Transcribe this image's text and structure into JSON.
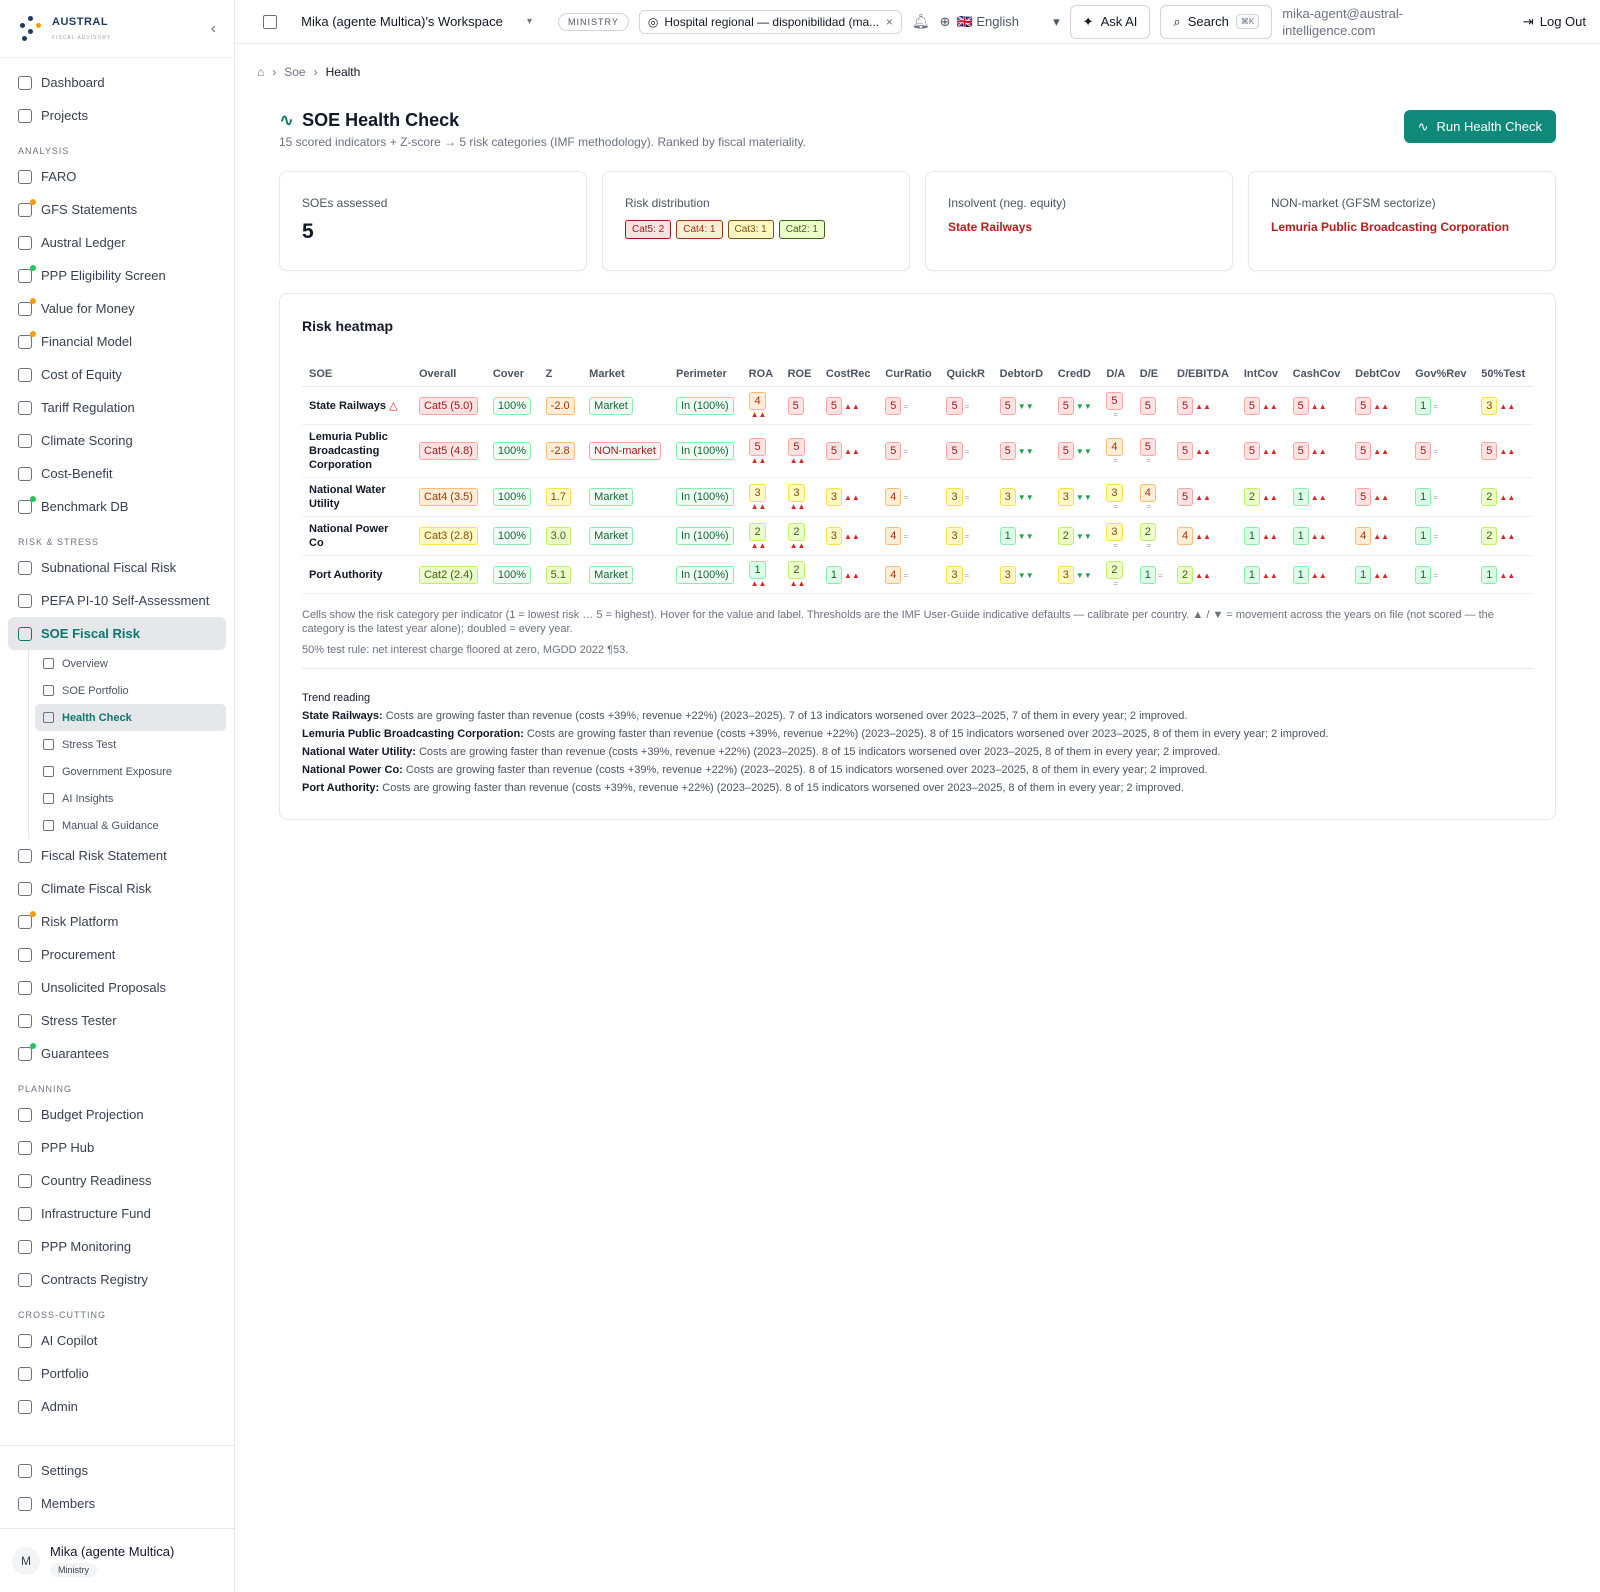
{
  "brand": {
    "name": "AUSTRAL",
    "tagline": "FISCAL ADVISORY"
  },
  "sidebar": {
    "top": [
      {
        "label": "Dashboard",
        "icon": "grid-icon"
      },
      {
        "label": "Projects",
        "icon": "folder-icon"
      }
    ],
    "sections": [
      {
        "title": "ANALYSIS",
        "items": [
          {
            "label": "FARO",
            "icon": "compass-icon"
          },
          {
            "label": "GFS Statements",
            "icon": "calculator-icon",
            "dot": "#f59e0b"
          },
          {
            "label": "Austral Ledger",
            "icon": "book-icon"
          },
          {
            "label": "PPP Eligibility Screen",
            "icon": "clipboard-check-icon",
            "dot": "#22c55e"
          },
          {
            "label": "Value for Money",
            "icon": "scale-icon",
            "dot": "#f59e0b"
          },
          {
            "label": "Financial Model",
            "icon": "sheet-icon",
            "dot": "#f59e0b"
          },
          {
            "label": "Cost of Equity",
            "icon": "trending-up-icon"
          },
          {
            "label": "Tariff Regulation",
            "icon": "gauge-icon"
          },
          {
            "label": "Climate Scoring",
            "icon": "cloud-icon"
          },
          {
            "label": "Cost-Benefit",
            "icon": "scale-icon"
          },
          {
            "label": "Benchmark DB",
            "icon": "bar-chart-icon",
            "dot": "#22c55e"
          }
        ]
      },
      {
        "title": "RISK & STRESS",
        "items": [
          {
            "label": "Subnational Fiscal Risk",
            "icon": "building-icon"
          },
          {
            "label": "PEFA PI-10 Self-Assessment",
            "icon": "clipboard-icon"
          },
          {
            "label": "SOE Fiscal Risk",
            "icon": "factory-icon",
            "active": true
          }
        ]
      }
    ],
    "soe_sub": [
      {
        "label": "Overview",
        "icon": "home-icon"
      },
      {
        "label": "SOE Portfolio",
        "icon": "briefcase-icon"
      },
      {
        "label": "Health Check",
        "icon": "activity-icon",
        "active": true
      },
      {
        "label": "Stress Test",
        "icon": "zap-icon"
      },
      {
        "label": "Government Exposure",
        "icon": "landmark-icon"
      },
      {
        "label": "AI Insights",
        "icon": "sparkles-icon"
      },
      {
        "label": "Manual & Guidance",
        "icon": "book-open-icon"
      }
    ],
    "risk_more": [
      {
        "label": "Fiscal Risk Statement",
        "icon": "shield-check-icon"
      },
      {
        "label": "Climate Fiscal Risk",
        "icon": "cloud-rain-icon"
      },
      {
        "label": "Risk Platform",
        "icon": "shield-alert-icon",
        "dot": "#f59e0b"
      },
      {
        "label": "Procurement",
        "icon": "clipboard-list-icon"
      },
      {
        "label": "Unsolicited Proposals",
        "icon": "file-icon"
      },
      {
        "label": "Stress Tester",
        "icon": "zap-icon"
      },
      {
        "label": "Guarantees",
        "icon": "shield-icon",
        "dot": "#22c55e"
      }
    ],
    "planning_title": "PLANNING",
    "planning": [
      {
        "label": "Budget Projection",
        "icon": "wallet-icon"
      },
      {
        "label": "PPP Hub",
        "icon": "database-icon"
      },
      {
        "label": "Country Readiness",
        "icon": "flag-icon"
      },
      {
        "label": "Infrastructure Fund",
        "icon": "landmark-icon"
      },
      {
        "label": "PPP Monitoring",
        "icon": "activity-icon"
      },
      {
        "label": "Contracts Registry",
        "icon": "files-icon"
      }
    ],
    "cross_title": "CROSS-CUTTING",
    "cross": [
      {
        "label": "AI Copilot",
        "icon": "sparkles-icon"
      },
      {
        "label": "Portfolio",
        "icon": "sparkles-icon"
      },
      {
        "label": "Admin",
        "icon": "gear-icon"
      }
    ],
    "bottom": [
      {
        "label": "Settings",
        "icon": "gear-icon"
      },
      {
        "label": "Members",
        "icon": "users-icon"
      }
    ],
    "user": {
      "initial": "M",
      "name": "Mika (agente Multica)",
      "role": "Ministry"
    }
  },
  "topbar": {
    "workspace": "Mika (agente Multica)'s Workspace",
    "tier": "MINISTRY",
    "project": "Hospital regional — disponibilidad (ma...",
    "language": "🇬🇧 English",
    "ask_ai": "Ask AI",
    "search": "Search",
    "search_kbd": "⌘K",
    "email": "mika-agent@austral-intelligence.com",
    "logout": "Log Out"
  },
  "breadcrumb": [
    "Soe",
    "Health"
  ],
  "page": {
    "title": "SOE Health Check",
    "subtitle": "15 scored indicators + Z-score → 5 risk categories (IMF methodology). Ranked by fiscal materiality.",
    "run_button": "Run Health Check"
  },
  "kpis": {
    "assessed_label": "SOEs assessed",
    "assessed_value": "5",
    "dist_label": "Risk distribution",
    "dist": [
      {
        "text": "Cat5: 2",
        "cls": "c5"
      },
      {
        "text": "Cat4: 1",
        "cls": "c4"
      },
      {
        "text": "Cat3: 1",
        "cls": "c3"
      },
      {
        "text": "Cat2: 1",
        "cls": "c2"
      }
    ],
    "insolvent_label": "Insolvent (neg. equity)",
    "insolvent_value": "State Railways",
    "nonmarket_label": "NON-market (GFSM sectorize)",
    "nonmarket_value": "Lemuria Public Broadcasting Corporation"
  },
  "heatmap": {
    "title": "Risk heatmap",
    "columns": [
      "SOE",
      "Overall",
      "Cover",
      "Z",
      "Market",
      "Perimeter",
      "ROA",
      "ROE",
      "CostRec",
      "CurRatio",
      "QuickR",
      "DebtorD",
      "CredD",
      "D/A",
      "D/E",
      "D/EBITDA",
      "IntCov",
      "CashCov",
      "DebtCov",
      "Gov%Rev",
      "50%Test"
    ],
    "rows": [
      {
        "soe": "State Railways",
        "warn": true,
        "overall": "Cat5 (5.0)",
        "ocat": 5,
        "cover": "100%",
        "z": "-2.0",
        "zcat": 4,
        "market": "Market",
        "perimeter": "In (100%)",
        "ind": [
          [
            4,
            "up",
            "s"
          ],
          [
            5,
            "",
            ""
          ],
          [
            5,
            "up",
            ""
          ],
          [
            5,
            "eq",
            ""
          ],
          [
            5,
            "eq",
            ""
          ],
          [
            5,
            "dn",
            ""
          ],
          [
            5,
            "dn",
            ""
          ],
          [
            5,
            "eq",
            "s"
          ],
          [
            5,
            "",
            ""
          ],
          [
            5,
            "up",
            ""
          ],
          [
            5,
            "up",
            ""
          ],
          [
            5,
            "up",
            ""
          ],
          [
            5,
            "up",
            ""
          ],
          [
            1,
            "eq",
            ""
          ],
          [
            3,
            "up",
            ""
          ]
        ]
      },
      {
        "soe": "Lemuria Public Broadcasting Corporation",
        "warn": false,
        "overall": "Cat5 (4.8)",
        "ocat": 5,
        "cover": "100%",
        "z": "-2.8",
        "zcat": 4,
        "market": "NON-market",
        "perimeter": "In (100%)",
        "ind": [
          [
            5,
            "up",
            "s"
          ],
          [
            5,
            "up",
            "s"
          ],
          [
            5,
            "up",
            ""
          ],
          [
            5,
            "eq",
            ""
          ],
          [
            5,
            "eq",
            ""
          ],
          [
            5,
            "dn",
            ""
          ],
          [
            5,
            "dn",
            ""
          ],
          [
            4,
            "eq",
            "s"
          ],
          [
            5,
            "eq",
            "s"
          ],
          [
            5,
            "up",
            ""
          ],
          [
            5,
            "up",
            ""
          ],
          [
            5,
            "up",
            ""
          ],
          [
            5,
            "up",
            ""
          ],
          [
            5,
            "eq",
            ""
          ],
          [
            5,
            "up",
            ""
          ]
        ]
      },
      {
        "soe": "National Water Utility",
        "warn": false,
        "overall": "Cat4 (3.5)",
        "ocat": 4,
        "cover": "100%",
        "z": "1.7",
        "zcat": 3,
        "market": "Market",
        "perimeter": "In (100%)",
        "ind": [
          [
            3,
            "up",
            "s"
          ],
          [
            3,
            "up",
            "s"
          ],
          [
            3,
            "up",
            ""
          ],
          [
            4,
            "eq",
            ""
          ],
          [
            3,
            "eq",
            ""
          ],
          [
            3,
            "dn",
            ""
          ],
          [
            3,
            "dn",
            ""
          ],
          [
            3,
            "eq",
            "s"
          ],
          [
            4,
            "eq",
            "s"
          ],
          [
            5,
            "up",
            ""
          ],
          [
            2,
            "up",
            ""
          ],
          [
            1,
            "up",
            ""
          ],
          [
            5,
            "up",
            ""
          ],
          [
            1,
            "eq",
            ""
          ],
          [
            2,
            "up",
            ""
          ]
        ]
      },
      {
        "soe": "National Power Co",
        "warn": false,
        "overall": "Cat3 (2.8)",
        "ocat": 3,
        "cover": "100%",
        "z": "3.0",
        "zcat": 2,
        "market": "Market",
        "perimeter": "In (100%)",
        "ind": [
          [
            2,
            "up",
            "s"
          ],
          [
            2,
            "up",
            "s"
          ],
          [
            3,
            "up",
            ""
          ],
          [
            4,
            "eq",
            ""
          ],
          [
            3,
            "eq",
            ""
          ],
          [
            1,
            "dn",
            ""
          ],
          [
            2,
            "dn",
            ""
          ],
          [
            3,
            "eq",
            "s"
          ],
          [
            2,
            "eq",
            "s"
          ],
          [
            4,
            "up",
            ""
          ],
          [
            1,
            "up",
            ""
          ],
          [
            1,
            "up",
            ""
          ],
          [
            4,
            "up",
            ""
          ],
          [
            1,
            "eq",
            ""
          ],
          [
            2,
            "up",
            ""
          ]
        ]
      },
      {
        "soe": "Port Authority",
        "warn": false,
        "overall": "Cat2 (2.4)",
        "ocat": 2,
        "cover": "100%",
        "z": "5.1",
        "zcat": 2,
        "market": "Market",
        "perimeter": "In (100%)",
        "ind": [
          [
            1,
            "up",
            "s"
          ],
          [
            2,
            "up",
            "s"
          ],
          [
            1,
            "up",
            ""
          ],
          [
            4,
            "eq",
            ""
          ],
          [
            3,
            "eq",
            ""
          ],
          [
            3,
            "dn",
            ""
          ],
          [
            3,
            "dn",
            ""
          ],
          [
            2,
            "eq",
            "s"
          ],
          [
            1,
            "eq",
            ""
          ],
          [
            2,
            "up",
            ""
          ],
          [
            1,
            "up",
            ""
          ],
          [
            1,
            "up",
            ""
          ],
          [
            1,
            "up",
            ""
          ],
          [
            1,
            "eq",
            ""
          ],
          [
            1,
            "up",
            ""
          ]
        ]
      }
    ],
    "note": "Cells show the risk category per indicator (1 = lowest risk … 5 = highest). Hover for the value and label. Thresholds are the IMF User-Guide indicative defaults — calibrate per country. ▲ / ▼ = movement across the years on file (not scored — the category is the latest year alone); doubled = every year.",
    "rule": "50% test rule: net interest charge floored at zero, MGDD 2022 ¶53."
  },
  "trend": {
    "title": "Trend reading",
    "items": [
      {
        "soe": "State Railways:",
        "text": "Costs are growing faster than revenue (costs +39%, revenue +22%) (2023–2025). 7 of 13 indicators worsened over 2023–2025, 7 of them in every year; 2 improved."
      },
      {
        "soe": "Lemuria Public Broadcasting Corporation:",
        "text": "Costs are growing faster than revenue (costs +39%, revenue +22%) (2023–2025). 8 of 15 indicators worsened over 2023–2025, 8 of them in every year; 2 improved."
      },
      {
        "soe": "National Water Utility:",
        "text": "Costs are growing faster than revenue (costs +39%, revenue +22%) (2023–2025). 8 of 15 indicators worsened over 2023–2025, 8 of them in every year; 2 improved."
      },
      {
        "soe": "National Power Co:",
        "text": "Costs are growing faster than revenue (costs +39%, revenue +22%) (2023–2025). 8 of 15 indicators worsened over 2023–2025, 8 of them in every year; 2 improved."
      },
      {
        "soe": "Port Authority:",
        "text": "Costs are growing faster than revenue (costs +39%, revenue +22%) (2023–2025). 8 of 15 indicators worsened over 2023–2025, 8 of them in every year; 2 improved."
      }
    ]
  }
}
